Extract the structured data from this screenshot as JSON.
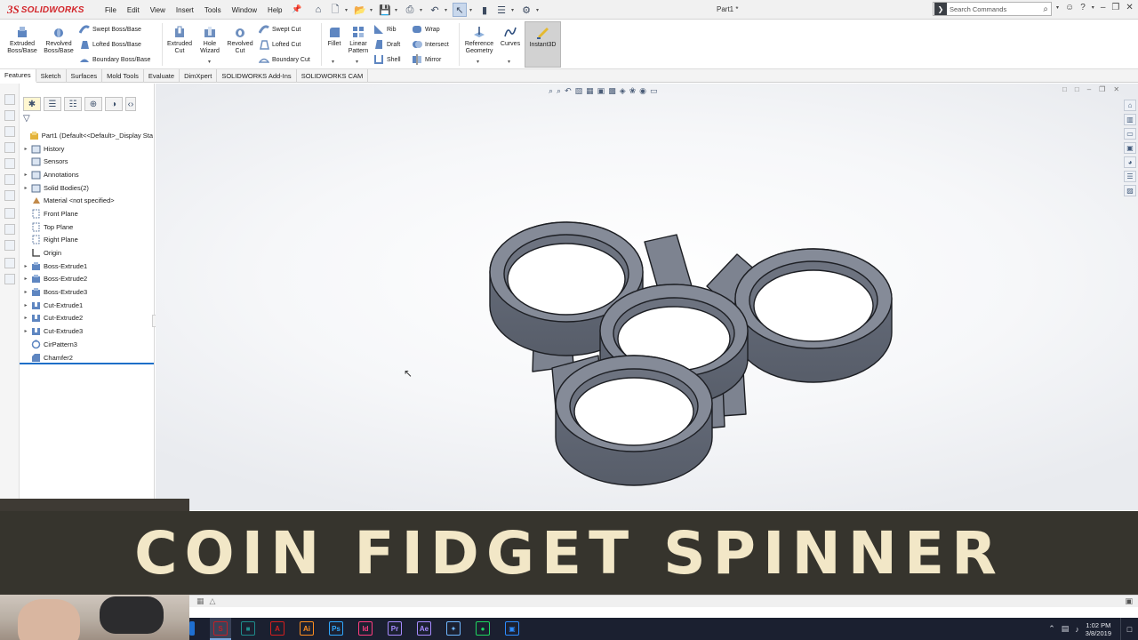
{
  "app": {
    "logo_ds": "3S",
    "logo_text": "SOLIDWORKS",
    "document_title": "Part1 *"
  },
  "menu": [
    "File",
    "Edit",
    "View",
    "Insert",
    "Tools",
    "Window",
    "Help"
  ],
  "search": {
    "placeholder": "Search Commands"
  },
  "commands": {
    "extruded_boss": "Extruded Boss/Base",
    "revolved_boss": "Revolved Boss/Base",
    "swept_boss": "Swept Boss/Base",
    "lofted_boss": "Lofted Boss/Base",
    "boundary_boss": "Boundary Boss/Base",
    "extruded_cut": "Extruded Cut",
    "hole_wizard": "Hole Wizard",
    "revolved_cut": "Revolved Cut",
    "swept_cut": "Swept Cut",
    "lofted_cut": "Lofted Cut",
    "boundary_cut": "Boundary Cut",
    "fillet": "Fillet",
    "linear_pattern": "Linear Pattern",
    "rib": "Rib",
    "draft": "Draft",
    "shell": "Shell",
    "wrap": "Wrap",
    "intersect": "Intersect",
    "mirror": "Mirror",
    "reference_geometry": "Reference Geometry",
    "curves": "Curves",
    "instant3d": "Instant3D"
  },
  "tabs": [
    "Features",
    "Sketch",
    "Surfaces",
    "Mold Tools",
    "Evaluate",
    "DimXpert",
    "SOLIDWORKS Add-Ins",
    "SOLIDWORKS CAM"
  ],
  "tree": [
    {
      "label": "Part1  (Default<<Default>_Display Sta",
      "expand": false,
      "icon": "part-icon"
    },
    {
      "label": "History",
      "expand": true,
      "icon": "folder-icon"
    },
    {
      "label": "Sensors",
      "expand": false,
      "icon": "folder-icon"
    },
    {
      "label": "Annotations",
      "expand": true,
      "icon": "folder-icon"
    },
    {
      "label": "Solid Bodies(2)",
      "expand": true,
      "icon": "folder-icon"
    },
    {
      "label": "Material <not specified>",
      "expand": false,
      "icon": "material-icon"
    },
    {
      "label": "Front Plane",
      "expand": false,
      "icon": "plane-icon"
    },
    {
      "label": "Top Plane",
      "expand": false,
      "icon": "plane-icon"
    },
    {
      "label": "Right Plane",
      "expand": false,
      "icon": "plane-icon"
    },
    {
      "label": "Origin",
      "expand": false,
      "icon": "origin-icon"
    },
    {
      "label": "Boss-Extrude1",
      "expand": true,
      "icon": "extrude-icon"
    },
    {
      "label": "Boss-Extrude2",
      "expand": true,
      "icon": "extrude-icon"
    },
    {
      "label": "Boss-Extrude3",
      "expand": true,
      "icon": "extrude-icon"
    },
    {
      "label": "Cut-Extrude1",
      "expand": true,
      "icon": "cut-icon"
    },
    {
      "label": "Cut-Extrude2",
      "expand": true,
      "icon": "cut-icon"
    },
    {
      "label": "Cut-Extrude3",
      "expand": true,
      "icon": "cut-icon"
    },
    {
      "label": "CirPattern3",
      "expand": false,
      "icon": "pattern-icon"
    },
    {
      "label": "Chamfer2",
      "expand": false,
      "icon": "chamfer-icon"
    }
  ],
  "banner": {
    "text": "COIN FIDGET SPINNER"
  },
  "taskbar": {
    "time": "1:02 PM",
    "date": "3/8/2019",
    "apps": [
      {
        "label": "S",
        "color": "#c21f26",
        "name": "solidworks-app-icon"
      },
      {
        "label": "■",
        "color": "#1e8c8c",
        "name": "app-teal-icon"
      },
      {
        "label": "A",
        "color": "#d21f1f",
        "name": "acrobat-app-icon"
      },
      {
        "label": "Ai",
        "color": "#ff8f1f",
        "name": "illustrator-app-icon"
      },
      {
        "label": "Ps",
        "color": "#30a8ff",
        "name": "photoshop-app-icon"
      },
      {
        "label": "Id",
        "color": "#ff3d7f",
        "name": "indesign-app-icon"
      },
      {
        "label": "Pr",
        "color": "#a68bff",
        "name": "premiere-app-icon"
      },
      {
        "label": "Ae",
        "color": "#a68bff",
        "name": "aftereffects-app-icon"
      },
      {
        "label": "✦",
        "color": "#6fb7ff",
        "name": "app-blue-icon"
      },
      {
        "label": "●",
        "color": "#1ed760",
        "name": "spotify-app-icon"
      },
      {
        "label": "▣",
        "color": "#2d8cff",
        "name": "app-lightblue-icon"
      }
    ]
  }
}
